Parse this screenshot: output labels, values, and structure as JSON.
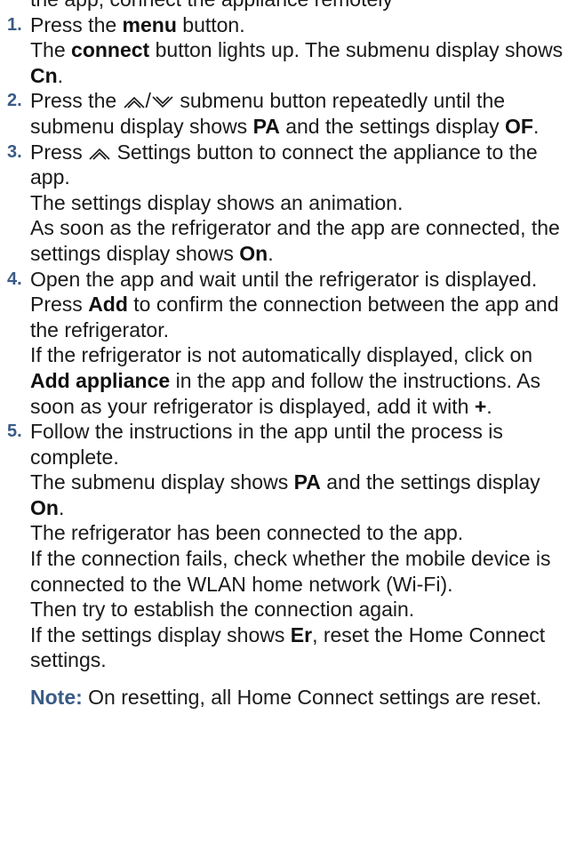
{
  "intro": "the app, connect the appliance remotely",
  "steps": [
    {
      "num": "1.",
      "p1": {
        "a": "Press the ",
        "b": "menu",
        "c": " button."
      },
      "p2": {
        "a": "The ",
        "b": "connect",
        "c": " button lights up. The submenu display shows ",
        "d": "Cn",
        "e": "."
      }
    },
    {
      "num": "2.",
      "a": "Press the ",
      "b": " submenu button repeatedly until the submenu display shows ",
      "c": "PA",
      "d": " and the settings display ",
      "e": "OF",
      "f": "."
    },
    {
      "num": "3.",
      "p1": {
        "a": "Press ",
        "b": " Settings button to connect the appliance to the app."
      },
      "p2": "The settings display shows an animation.",
      "p3": {
        "a": "As soon as the refrigerator and the app are connected, the settings display shows ",
        "b": "On",
        "c": "."
      }
    },
    {
      "num": "4.",
      "p1": "Open the app and wait until the refrigerator is displayed.",
      "p2": {
        "a": "Press ",
        "b": "Add",
        "c": " to confirm the connection between the app and the refrigerator."
      },
      "p3": {
        "a": "If the refrigerator is not automatically displayed, click on ",
        "b": "Add appliance",
        "c": " in the app and follow the instructions. As soon as your refrigerator is displayed, add it with ",
        "d": "+",
        "e": "."
      }
    },
    {
      "num": "5.",
      "p1": "Follow the instructions in the app until the process is complete.",
      "p2": {
        "a": "The submenu display shows ",
        "b": "PA",
        "c": " and the settings display ",
        "d": "On",
        "e": "."
      },
      "p3": "The refrigerator has been connected to the app.",
      "p4": "If the connection fails, check whether the mobile device is connected to the WLAN home network (Wi-Fi).",
      "p5": "Then try to establish the connection again.",
      "p6": {
        "a": "If the settings display shows ",
        "b": "Er",
        "c": ", reset the Home Connect settings."
      }
    }
  ],
  "note": {
    "label": "Note:",
    "text": " On resetting, all Home Connect settings are reset."
  },
  "icons": {
    "up": "chevron-double-up-icon",
    "down": "chevron-double-down-icon",
    "color": "#1a1a1a"
  },
  "colors": {
    "accent": "#3a5b86",
    "text": "#1a1a1a"
  }
}
